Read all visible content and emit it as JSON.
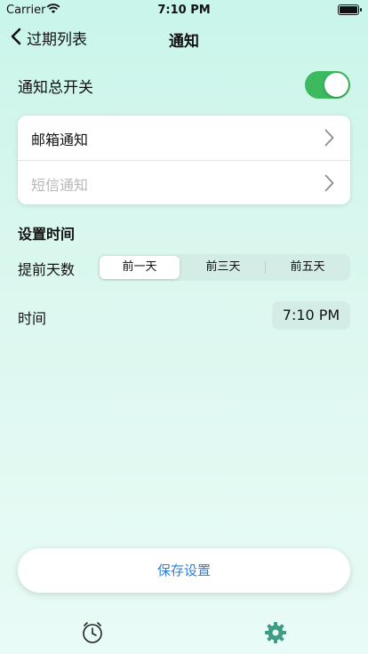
{
  "status_bar": {
    "carrier": "Carrier",
    "time": "7:10 PM"
  },
  "nav": {
    "back_label": "过期列表",
    "title": "通知"
  },
  "master_toggle": {
    "label": "通知总开关",
    "on": true
  },
  "channels": [
    {
      "label": "邮箱通知",
      "enabled": true
    },
    {
      "label": "短信通知",
      "enabled": false
    }
  ],
  "schedule": {
    "section_title": "设置时间",
    "days_label": "提前天数",
    "options": [
      "前一天",
      "前三天",
      "前五天"
    ],
    "selected_option": "前一天",
    "time_label": "时间",
    "time_value": "7:10 PM"
  },
  "save_button": "保存设置",
  "tabbar": {
    "left_icon": "clock-list-icon",
    "right_icon": "gear-icon",
    "active_color": "#3e9c86"
  },
  "colors": {
    "toggle_on": "#3dba5f",
    "link": "#2f7fd3",
    "background": "#d9f7ee"
  }
}
